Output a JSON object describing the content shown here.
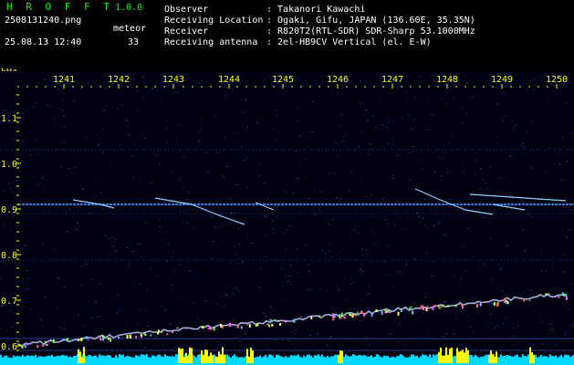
{
  "header": {
    "app_title": "H R O F F T",
    "app_version": "1.0.0",
    "filename": "2508131240.png",
    "meteor_label": "meteor",
    "datetime": "25.08.13 12:40",
    "meteor_count": "33"
  },
  "info": [
    {
      "label": "Observer",
      "value": ": Takanori Kawachi"
    },
    {
      "label": "Receiving Location",
      "value": ": Ogaki, Gifu, JAPAN (136.60E, 35.35N)"
    },
    {
      "label": "Receiver",
      "value": ": R820T2(RTL-SDR) SDR-Sharp 53.1000MHz"
    },
    {
      "label": "Receiving antenna",
      "value": ": 2el-HB9CV Vertical (el. E-W)"
    }
  ],
  "axis": {
    "y_unit": "kHz",
    "x_ticks": [
      "1241",
      "1242",
      "1243",
      "1244",
      "1245",
      "1246",
      "1247",
      "1248",
      "1249",
      "1250"
    ],
    "y_ticks": [
      "1.1",
      "1.0",
      "0.9",
      "0.8",
      "0.7",
      "0.6"
    ]
  },
  "colors": {
    "background": "#000010",
    "axis_text": "#ffff00",
    "header_text": "#ffffff",
    "title_text": "#00ff00",
    "carrier": "#5aa0ff",
    "bottom_bar": "#00d8ff",
    "peaks": "#ffff00"
  }
}
